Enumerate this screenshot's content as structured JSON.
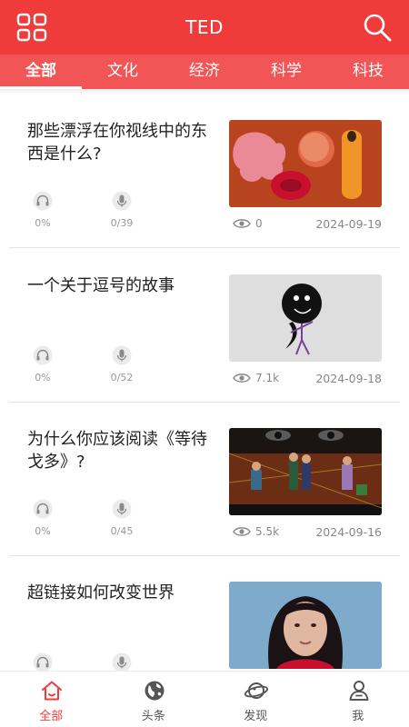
{
  "header": {
    "title": "TED",
    "menu_icon": "grid-menu-icon",
    "search_icon": "search-icon"
  },
  "tabs": [
    {
      "label": "全部",
      "active": true
    },
    {
      "label": "文化",
      "active": false
    },
    {
      "label": "经济",
      "active": false
    },
    {
      "label": "科学",
      "active": false
    },
    {
      "label": "科技",
      "active": false
    }
  ],
  "articles": [
    {
      "title": "那些漂浮在你视线中的东西是什么?",
      "listen_progress": "0%",
      "speak_progress": "0/39",
      "views": "0",
      "date": "2024-09-19"
    },
    {
      "title": "一个关于逗号的故事",
      "listen_progress": "0%",
      "speak_progress": "0/52",
      "views": "7.1k",
      "date": "2024-09-18"
    },
    {
      "title": "为什么你应该阅读《等待戈多》?",
      "listen_progress": "0%",
      "speak_progress": "0/45",
      "views": "5.5k",
      "date": "2024-09-16"
    },
    {
      "title": "超链接如何改变世界",
      "listen_progress": "",
      "speak_progress": "",
      "views": "",
      "date": ""
    }
  ],
  "bottom_nav": [
    {
      "label": "全部",
      "icon": "home-icon",
      "active": true
    },
    {
      "label": "头条",
      "icon": "globe-icon",
      "active": false
    },
    {
      "label": "发现",
      "icon": "planet-icon",
      "active": false
    },
    {
      "label": "我",
      "icon": "user-icon",
      "active": false
    }
  ],
  "colors": {
    "brand": "#f03b3b",
    "tab_bar": "#f25555",
    "muted_text": "#999999"
  }
}
